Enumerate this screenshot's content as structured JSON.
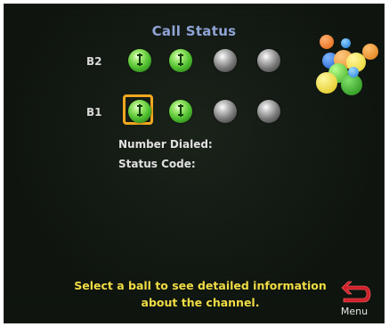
{
  "title": "Call Status",
  "rows": [
    {
      "label": "B2",
      "balls": [
        {
          "status": "active",
          "color": "#4fbf2f",
          "icon": "phone-icon"
        },
        {
          "status": "active",
          "color": "#4fbf2f",
          "icon": "phone-icon"
        },
        {
          "status": "idle",
          "color": "#7a7a7a"
        },
        {
          "status": "idle",
          "color": "#7a7a7a"
        }
      ]
    },
    {
      "label": "B1",
      "balls": [
        {
          "status": "active",
          "color": "#4fbf2f",
          "icon": "phone-icon",
          "selected": true
        },
        {
          "status": "active",
          "color": "#4fbf2f",
          "icon": "phone-icon"
        },
        {
          "status": "idle",
          "color": "#7a7a7a"
        },
        {
          "status": "idle",
          "color": "#7a7a7a"
        }
      ]
    }
  ],
  "details": {
    "number_dialed_label": "Number Dialed:",
    "status_code_label": "Status Code:"
  },
  "hint_line1": "Select a ball to see detailed information",
  "hint_line2": "about the channel.",
  "menu": {
    "label": "Menu",
    "icon": "back-arrow-icon",
    "icon_color": "#d0202a"
  },
  "colors": {
    "title": "#8fa4d6",
    "hint": "#f0dc45",
    "selection": "#f0a81e"
  },
  "logo": {
    "icon": "colored-balls-logo-icon"
  }
}
